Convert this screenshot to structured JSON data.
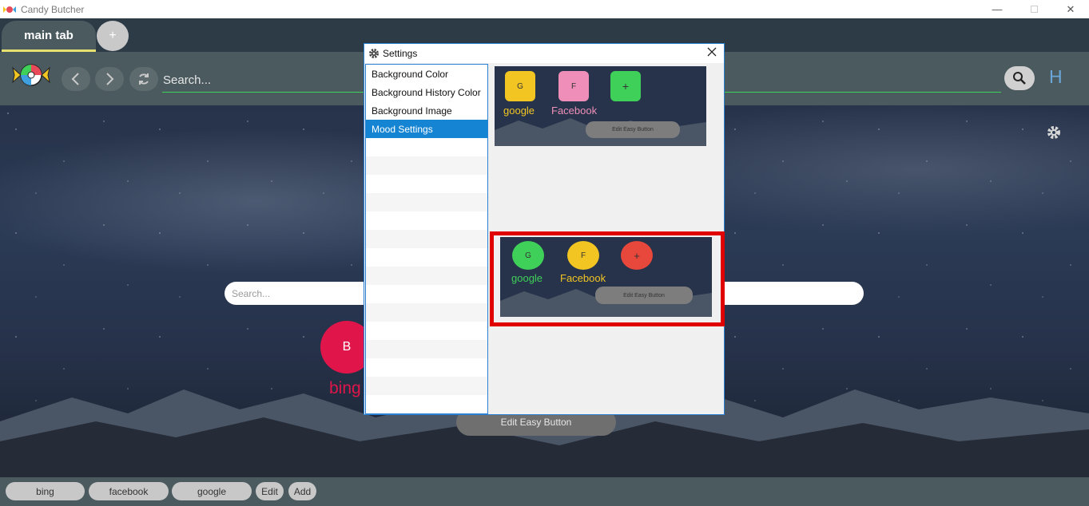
{
  "window": {
    "title": "Candy Butcher",
    "minimize_glyph": "—",
    "maximize_glyph": "☐",
    "close_glyph": "✕"
  },
  "tabs": {
    "main_label": "main tab",
    "add_label": "+"
  },
  "nav": {
    "search_placeholder": "Search...",
    "history_label": "H",
    "icons": [
      "candy-logo-icon",
      "back-icon",
      "forward-icon",
      "refresh-icon",
      "search-icon"
    ]
  },
  "page": {
    "search_placeholder": "Search...",
    "easy_button": {
      "letter": "B",
      "label": "bing",
      "color": "#e0154a"
    },
    "edit_easy_label": "Edit Easy Button"
  },
  "bottom_bar": {
    "items": [
      "bing",
      "facebook",
      "google",
      "Edit",
      "Add"
    ]
  },
  "settings_dialog": {
    "title": "Settings",
    "menu": [
      "Background Color",
      "Background History Color",
      "Background Image",
      "Mood Settings"
    ],
    "selected_index": 3,
    "moods": [
      {
        "buttons": [
          {
            "letter": "G",
            "label": "google",
            "color": "#f2c523",
            "label_color": "#f2c523"
          },
          {
            "letter": "F",
            "label": "Facebook",
            "color": "#ef8fb9",
            "label_color": "#ef8fb9"
          },
          {
            "letter": "+",
            "label": "",
            "color": "#3fd05a",
            "label_color": ""
          }
        ],
        "edit_label": "Edit Easy Button",
        "selected": false
      },
      {
        "buttons": [
          {
            "letter": "G",
            "label": "google",
            "color": "#3fd05a",
            "label_color": "#3fd05a"
          },
          {
            "letter": "F",
            "label": "Facebook",
            "color": "#f2c523",
            "label_color": "#f2c523"
          },
          {
            "letter": "+",
            "label": "",
            "color": "#e8473c",
            "label_color": ""
          }
        ],
        "edit_label": "Edit Easy Button",
        "selected": true
      }
    ]
  }
}
